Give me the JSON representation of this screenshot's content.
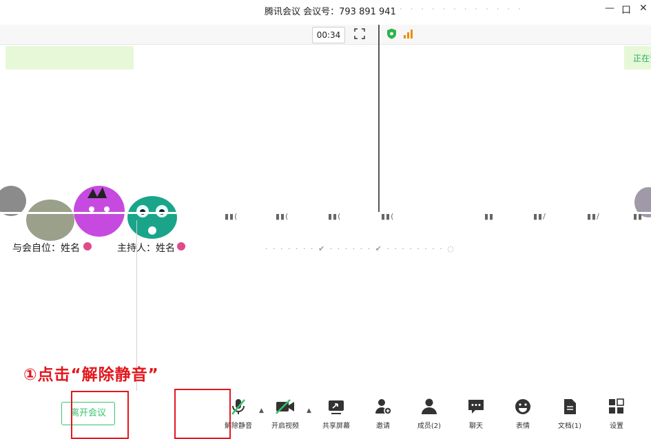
{
  "titlebar": {
    "left_text": "",
    "title": "腾讯会议 会议号：793 891 941",
    "window_controls": [
      "—",
      "口",
      "✕"
    ]
  },
  "status": {
    "timer": "00:34"
  },
  "notices": {
    "left": "",
    "right": "正在讲话"
  },
  "participants": [
    {
      "name": "与会自位：姓名"
    },
    {
      "name": "主持人：姓名"
    }
  ],
  "instruction": "①点击“解除静音”",
  "toolbar": {
    "leave_label": "离开会议",
    "items": [
      {
        "label": "解除静音",
        "icon": "mic-muted-icon"
      },
      {
        "label": "开启视频",
        "icon": "video-off-icon"
      },
      {
        "label": "共享屏幕",
        "icon": "share-screen-icon"
      },
      {
        "label": "邀请",
        "icon": "invite-icon"
      },
      {
        "label": "成员(2)",
        "icon": "members-icon"
      },
      {
        "label": "聊天",
        "icon": "chat-icon"
      },
      {
        "label": "表情",
        "icon": "emoji-icon"
      },
      {
        "label": "文档(1)",
        "icon": "document-icon"
      },
      {
        "label": "设置",
        "icon": "settings-icon"
      }
    ]
  },
  "colors": {
    "accent_green": "#35c46a",
    "highlight_red": "#e3161d",
    "notice_bg": "#e6f8d8"
  }
}
